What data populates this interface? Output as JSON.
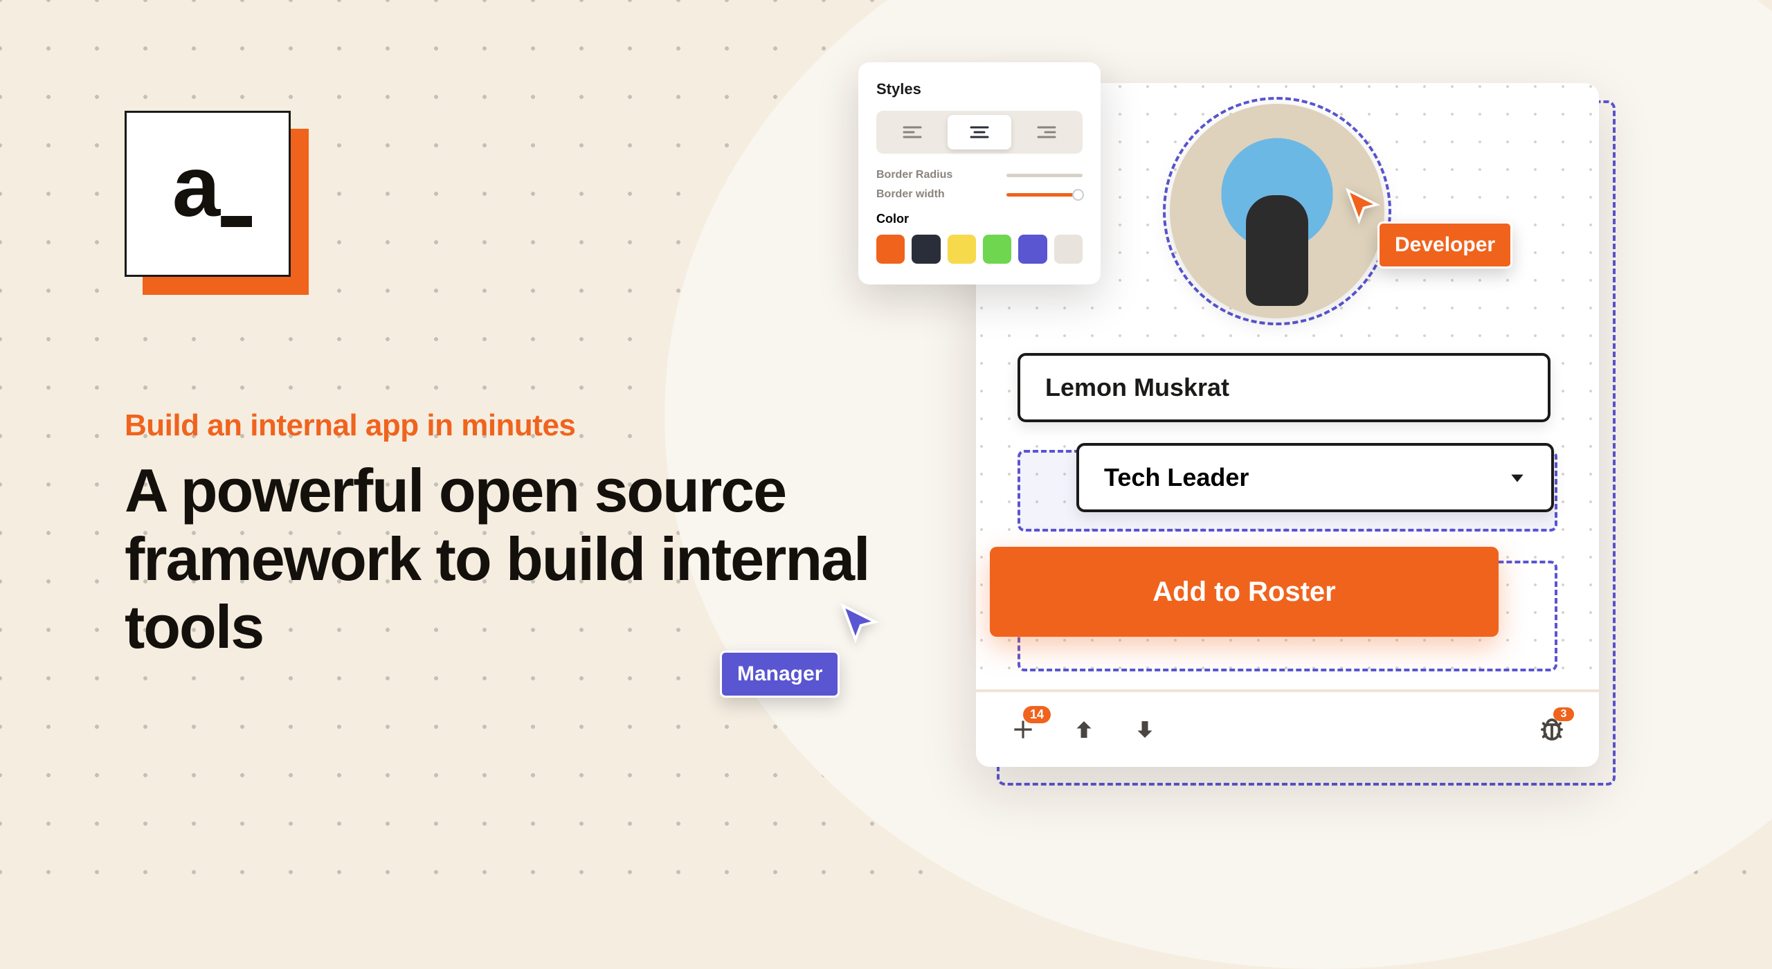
{
  "logo": {
    "text": "a_"
  },
  "hero": {
    "tagline": "Build an internal app in minutes",
    "headline": "A powerful open source framework to build internal tools"
  },
  "styles_panel": {
    "title": "Styles",
    "border_radius_label": "Border Radius",
    "border_width_label": "Border width",
    "color_label": "Color",
    "swatches": [
      "#f0631d",
      "#2a2e3a",
      "#f7d94c",
      "#6fd64f",
      "#5a55d1",
      "#e8e4dd"
    ]
  },
  "form": {
    "name_value": "Lemon Muskrat",
    "role_value": "Tech Leader",
    "submit_label": "Add to Roster"
  },
  "cursors": {
    "developer_label": "Developer",
    "manager_label": "Manager"
  },
  "footer": {
    "add_badge": "14",
    "bug_badge": "3"
  }
}
